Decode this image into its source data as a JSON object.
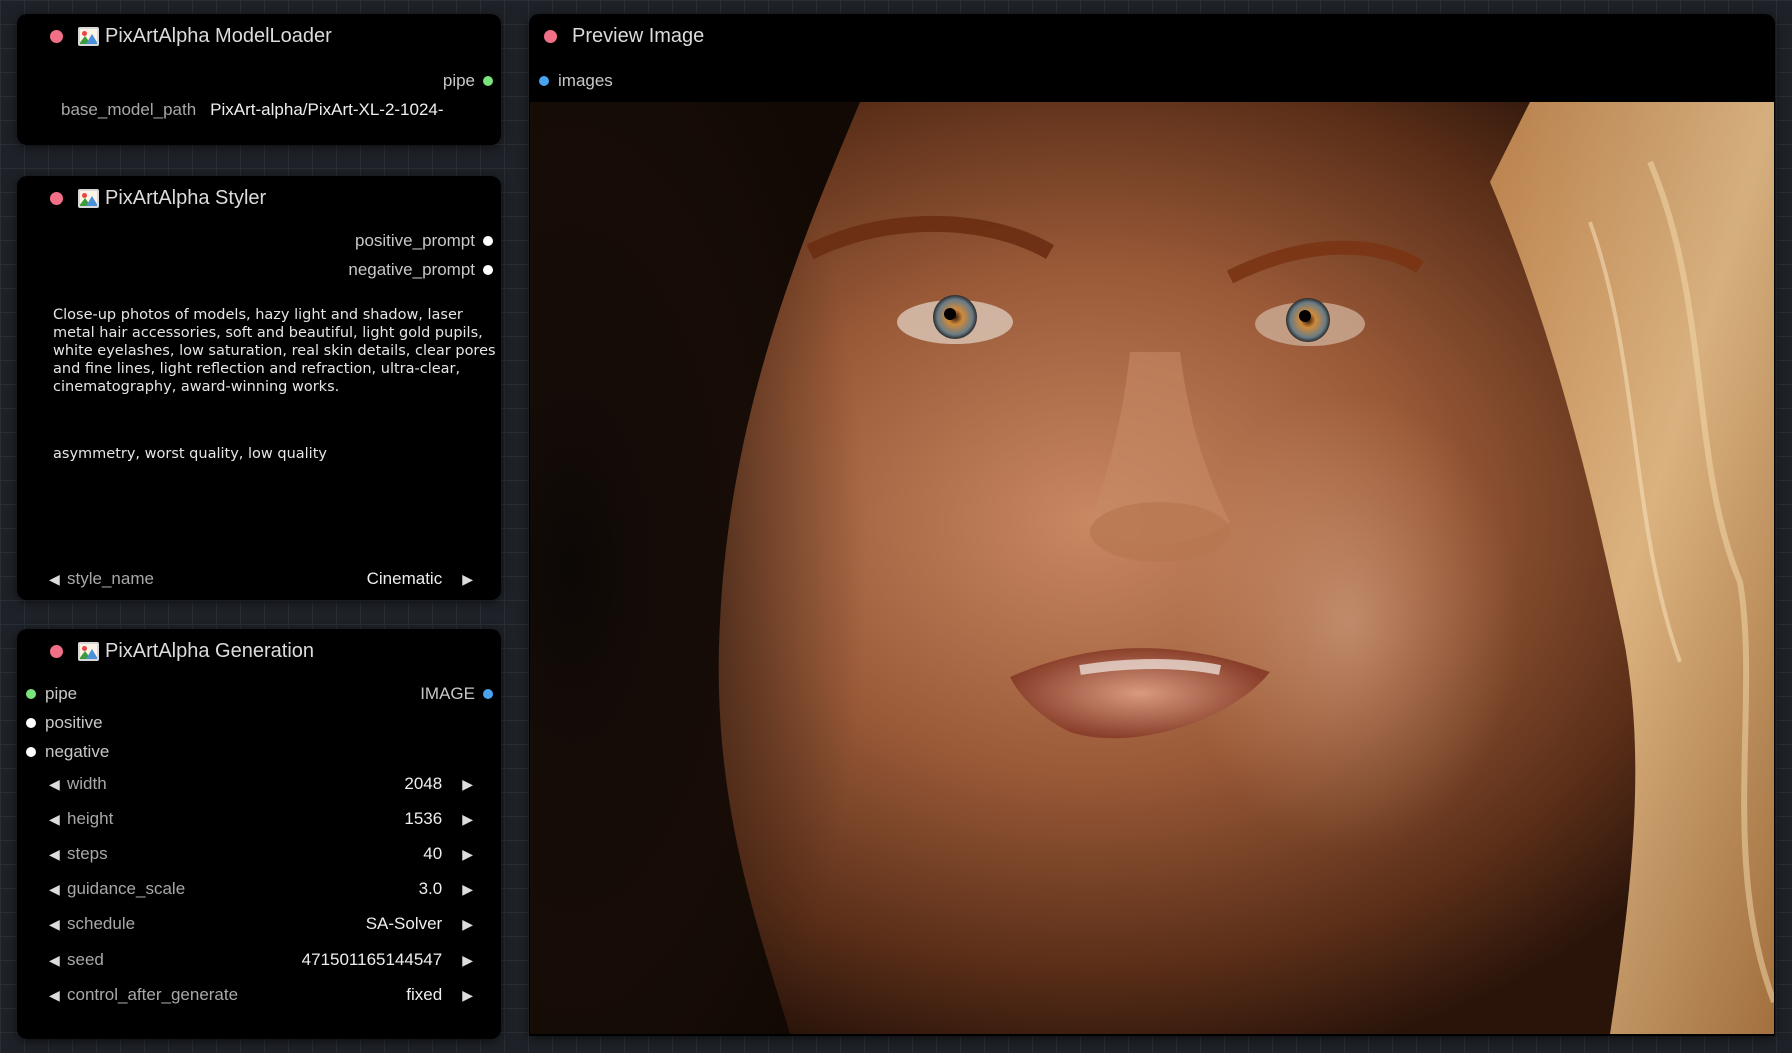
{
  "nodes": {
    "model_loader": {
      "title": "PixArtAlpha ModelLoader",
      "output_pipe": "pipe",
      "param_name": "base_model_path",
      "param_value": "PixArt-alpha/PixArt-XL-2-1024-"
    },
    "styler": {
      "title": "PixArtAlpha Styler",
      "output_positive": "positive_prompt",
      "output_negative": "negative_prompt",
      "positive_text": "Close-up photos of models, hazy light and shadow, laser metal hair accessories, soft and beautiful, light gold pupils, white eyelashes, low saturation, real skin details, clear pores and fine lines, light reflection and refraction, ultra-clear, cinematography, award-winning works.",
      "negative_text": "asymmetry, worst quality, low quality",
      "style_name_label": "style_name",
      "style_name_value": "Cinematic"
    },
    "generation": {
      "title": "PixArtAlpha Generation",
      "input_pipe": "pipe",
      "input_positive": "positive",
      "input_negative": "negative",
      "output_image": "IMAGE",
      "widgets": [
        {
          "label": "width",
          "value": "2048"
        },
        {
          "label": "height",
          "value": "1536"
        },
        {
          "label": "steps",
          "value": "40"
        },
        {
          "label": "guidance_scale",
          "value": "3.0"
        },
        {
          "label": "schedule",
          "value": "SA-Solver"
        },
        {
          "label": "seed",
          "value": "471501165144547"
        },
        {
          "label": "control_after_generate",
          "value": "fixed"
        }
      ]
    },
    "preview": {
      "title": "Preview Image",
      "input_images": "images"
    }
  },
  "icons": {
    "arrow_left": "◀",
    "arrow_right": "▶",
    "title_icon": "framed-picture-icon"
  },
  "colors": {
    "title_dot": "#f16f87",
    "pipe_slot": "#7be37b",
    "image_slot": "#4aa3f0",
    "conditioning_slot": "#ffffff"
  }
}
